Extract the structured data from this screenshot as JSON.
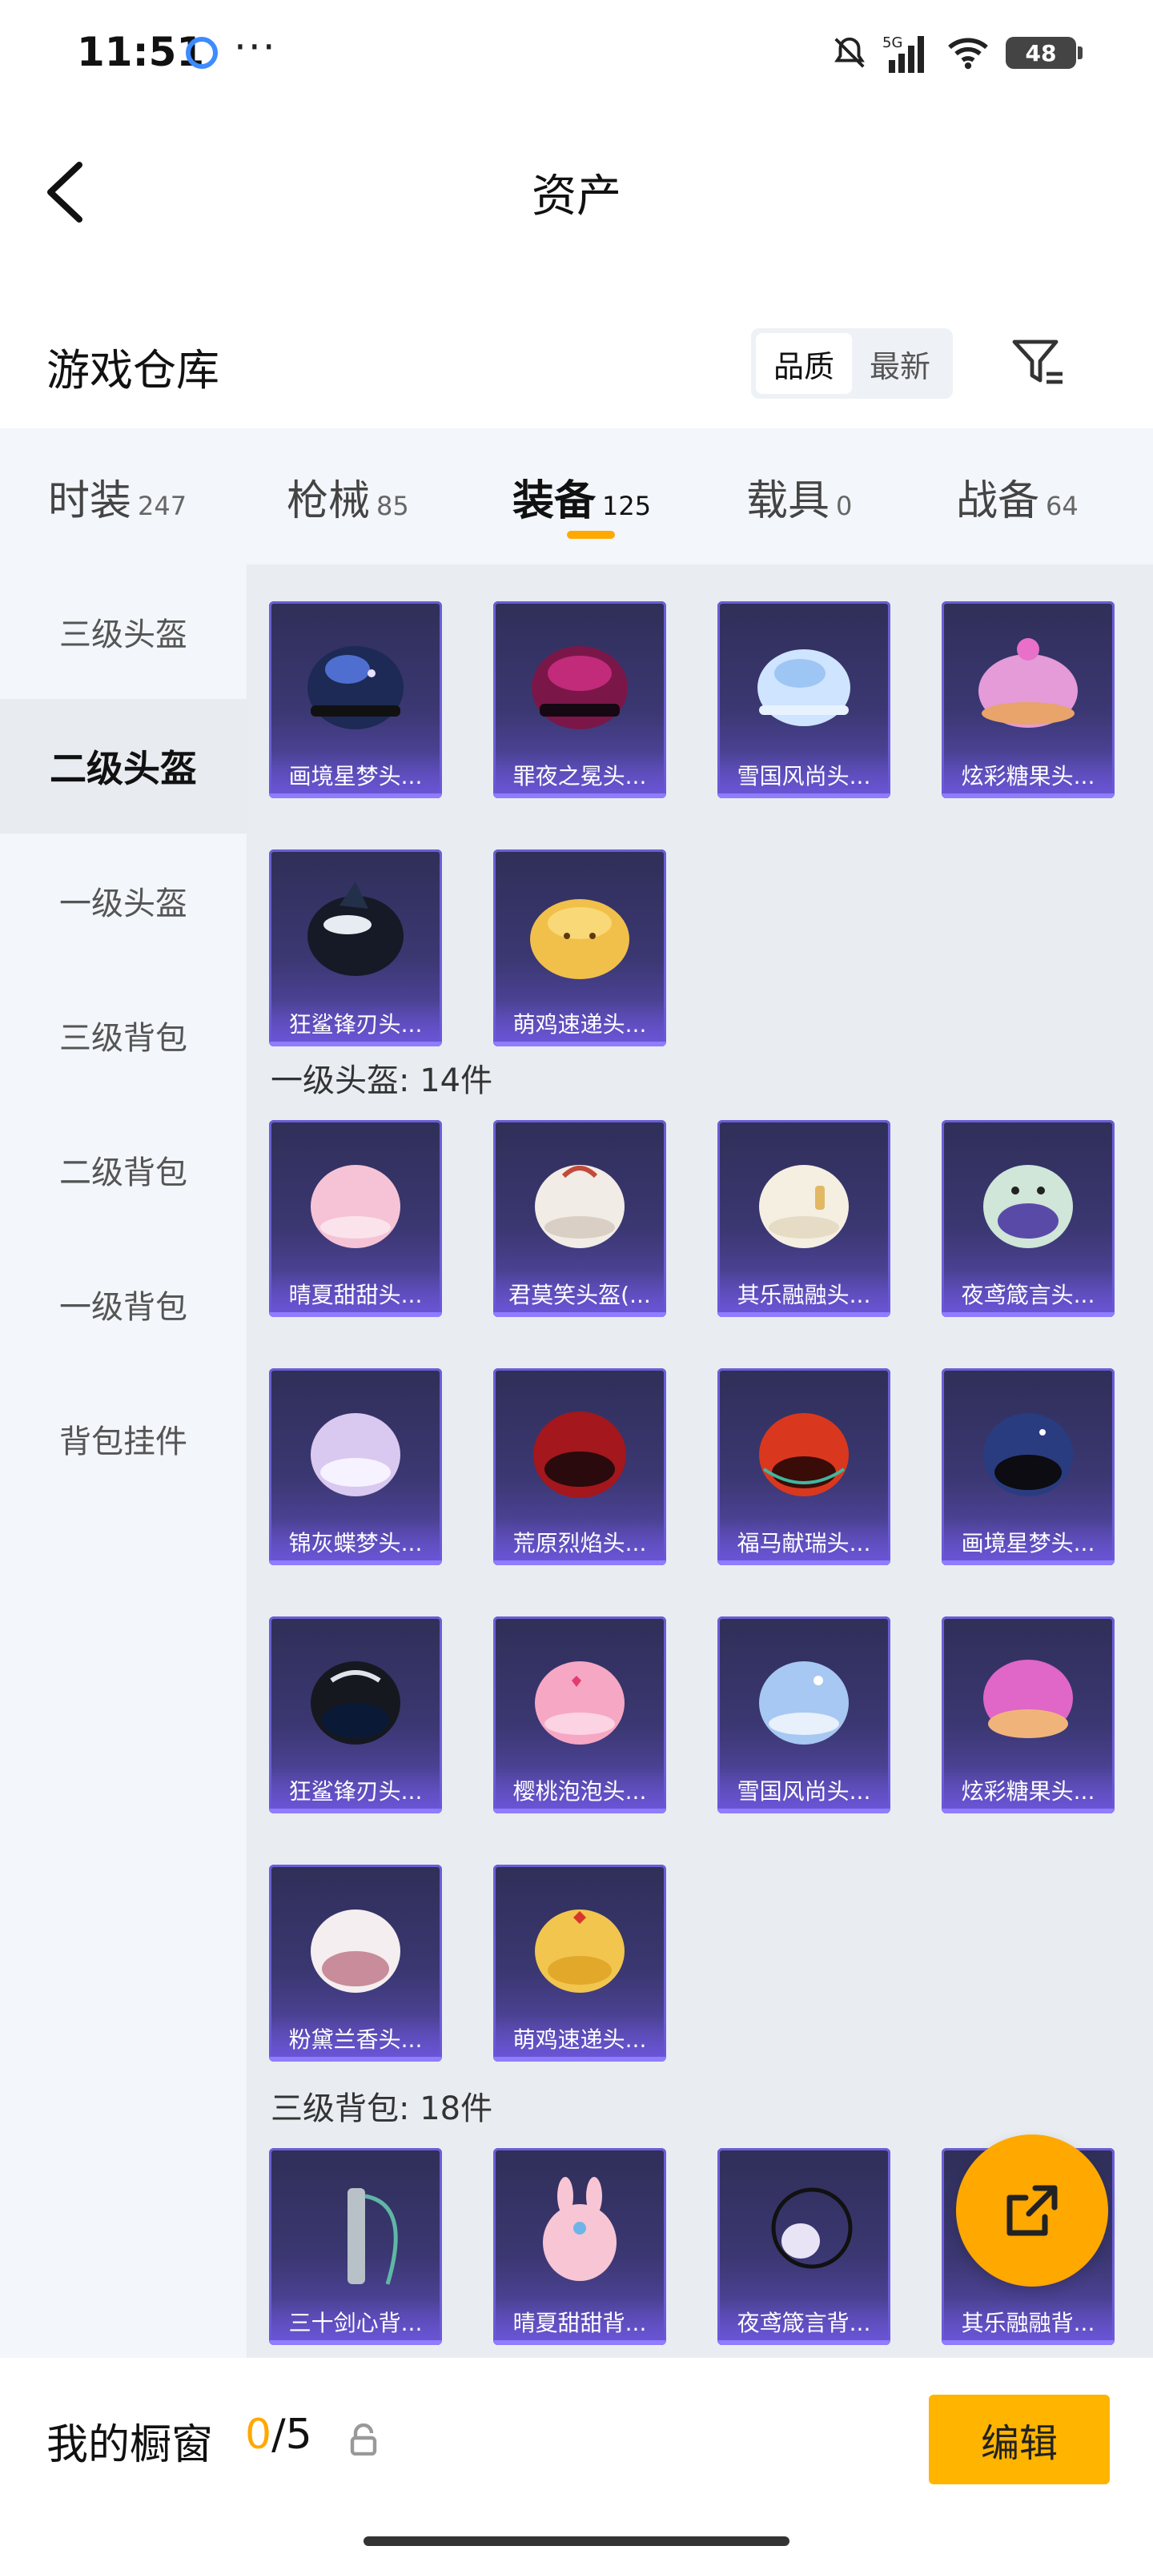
{
  "status_bar": {
    "time": "11:51",
    "dots": "···",
    "network": "5G",
    "battery": "48"
  },
  "header": {
    "title": "资产"
  },
  "warehouse": {
    "title": "游戏仓库",
    "sort_options": [
      "品质",
      "最新"
    ],
    "active_sort": "品质"
  },
  "category_tabs": [
    {
      "label": "时装",
      "count": "247"
    },
    {
      "label": "枪械",
      "count": "85"
    },
    {
      "label": "装备",
      "count": "125",
      "active": true
    },
    {
      "label": "载具",
      "count": "0"
    },
    {
      "label": "战备",
      "count": "64"
    }
  ],
  "sidebar": {
    "items": [
      "三级头盔",
      "二级头盔",
      "一级头盔",
      "三级背包",
      "二级背包",
      "一级背包",
      "背包挂件"
    ],
    "active": "二级头盔"
  },
  "sections": [
    {
      "label": "",
      "items": [
        "画境星梦头...",
        "罪夜之冕头...",
        "雪国风尚头...",
        "炫彩糖果头...",
        "狂鲨锋刃头...",
        "萌鸡速递头..."
      ]
    },
    {
      "label": "一级头盔: 14件",
      "items": [
        "晴夏甜甜头...",
        "君莫笑头盔(...",
        "其乐融融头...",
        "夜鸢箴言头...",
        "锦灰蝶梦头...",
        "荒原烈焰头...",
        "福马献瑞头...",
        "画境星梦头...",
        "狂鲨锋刃头...",
        "樱桃泡泡头...",
        "雪国风尚头...",
        "炫彩糖果头...",
        "粉黛兰香头...",
        "萌鸡速递头..."
      ]
    },
    {
      "label": "三级背包: 18件",
      "items": [
        "三十剑心背...",
        "晴夏甜甜背...",
        "夜鸢箴言背...",
        "其乐融融背..."
      ]
    }
  ],
  "bottom_bar": {
    "title": "我的橱窗",
    "current": "0",
    "total": "/5",
    "edit_label": "编辑"
  },
  "colors": {
    "accent": "#ffa800",
    "card_bg": "#3b3772",
    "card_border": "#6a5ed6"
  },
  "icons": [
    "back-arrow-icon",
    "filter-icon",
    "share-icon",
    "lock-icon",
    "mute-icon",
    "signal-icon",
    "wifi-icon",
    "battery-icon"
  ]
}
